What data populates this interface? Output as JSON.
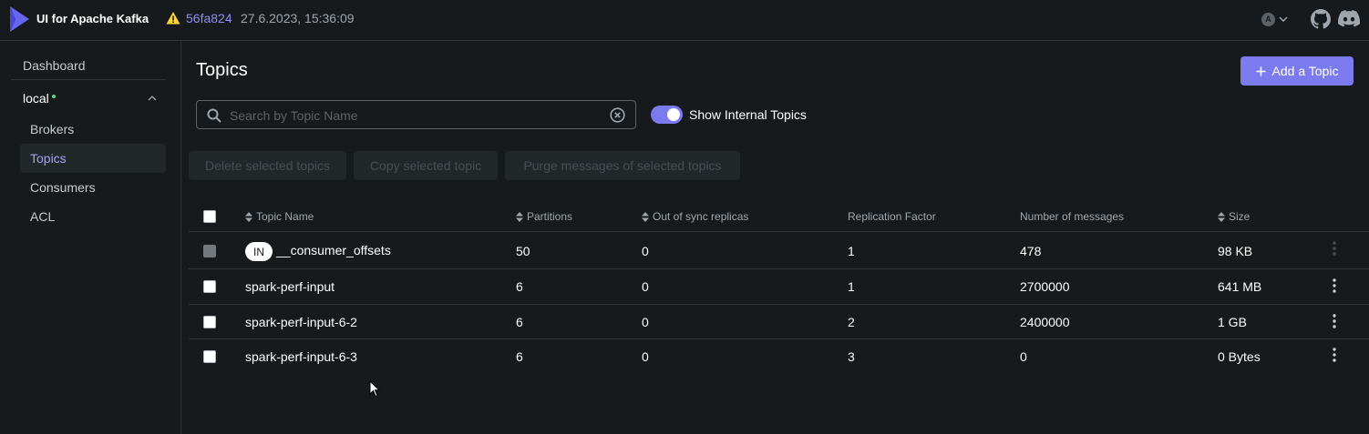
{
  "navbar": {
    "brand": "UI for Apache Kafka",
    "commit": "56fa824",
    "build_date": "27.6.2023, 15:36:09",
    "avatar_letter": "A"
  },
  "sidebar": {
    "dashboard": "Dashboard",
    "cluster": "local",
    "items": [
      "Brokers",
      "Topics",
      "Consumers",
      "ACL"
    ],
    "active_item": "Topics"
  },
  "main": {
    "title": "Topics",
    "add_button": "Add a Topic",
    "search_placeholder": "Search by Topic Name",
    "toggle_label": "Show Internal Topics",
    "toggle_on": true,
    "batch_actions": [
      "Delete selected topics",
      "Copy selected topic",
      "Purge messages of selected topics"
    ]
  },
  "table": {
    "columns": [
      "Topic Name",
      "Partitions",
      "Out of sync replicas",
      "Replication Factor",
      "Number of messages",
      "Size"
    ],
    "internal_tag": "IN",
    "rows": [
      {
        "name": "__consumer_offsets",
        "internal": true,
        "partitions": "50",
        "out_of_sync": "0",
        "replication": "1",
        "messages": "478",
        "size": "98 KB"
      },
      {
        "name": "spark-perf-input",
        "internal": false,
        "partitions": "6",
        "out_of_sync": "0",
        "replication": "1",
        "messages": "2700000",
        "size": "641 MB"
      },
      {
        "name": "spark-perf-input-6-2",
        "internal": false,
        "partitions": "6",
        "out_of_sync": "0",
        "replication": "2",
        "messages": "2400000",
        "size": "1 GB"
      },
      {
        "name": "spark-perf-input-6-3",
        "internal": false,
        "partitions": "6",
        "out_of_sync": "0",
        "replication": "3",
        "messages": "0",
        "size": "0 Bytes"
      }
    ]
  },
  "colors": {
    "background": "#171A1C",
    "accent": "#7B7BEF",
    "commit_link": "#8F8FF6",
    "warning": "#FFD439",
    "status_online": "#5CD685"
  }
}
